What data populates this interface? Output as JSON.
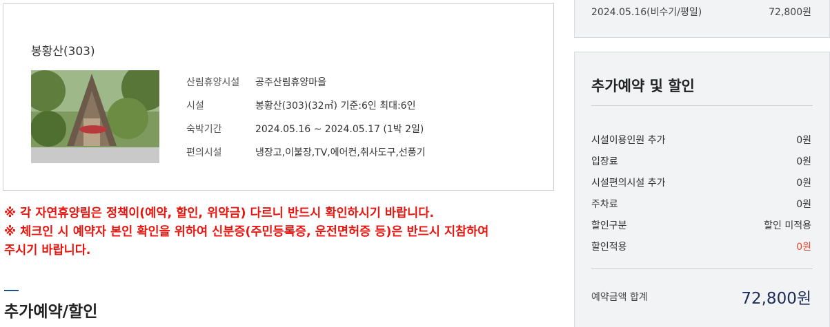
{
  "facility": {
    "name": "봉황산(303)",
    "rows": [
      {
        "label": "산림휴양시설",
        "value": "공주산림휴양마을"
      },
      {
        "label": "시설",
        "value": "봉황산(303)(32㎡) 기준:6인 최대:6인"
      },
      {
        "label": "숙박기간",
        "value": "2024.05.16 ~ 2024.05.17 (1박 2일)"
      },
      {
        "label": "편의시설",
        "value": "냉장고,이불장,TV,에어컨,취사도구,선풍기"
      }
    ]
  },
  "notices": [
    "※ 각 자연휴양림은 정책이(예약, 할인, 위약금) 다르니 반드시 확인하시기 바랍니다.",
    "※ 체크인 시 예약자 본인 확인을 위하여 신분증(주민등록증, 운전면허증 등)은 반드시 지참하여",
    "주시기 바랍니다."
  ],
  "section": {
    "title": "추가예약/할인"
  },
  "date_row": {
    "label": "2024.05.16(비수기/평일)",
    "price": "72,800원"
  },
  "summary": {
    "title": "추가예약 및 할인",
    "items": [
      {
        "label": "시설이용인원 추가",
        "value": "0원"
      },
      {
        "label": "입장료",
        "value": "0원"
      },
      {
        "label": "시설편의시설 추가",
        "value": "0원"
      },
      {
        "label": "주차료",
        "value": "0원"
      },
      {
        "label": "할인구분",
        "value": "할인 미적용"
      },
      {
        "label": "할인적용",
        "value": "0원"
      }
    ],
    "total_label": "예약금액 합계",
    "total_value": "72,800원"
  },
  "colors": {
    "notice_red": "#e8150f",
    "discount_red": "#e8452f",
    "total_navy": "#1d2c5a",
    "panel_bg": "#f2f3f5"
  }
}
